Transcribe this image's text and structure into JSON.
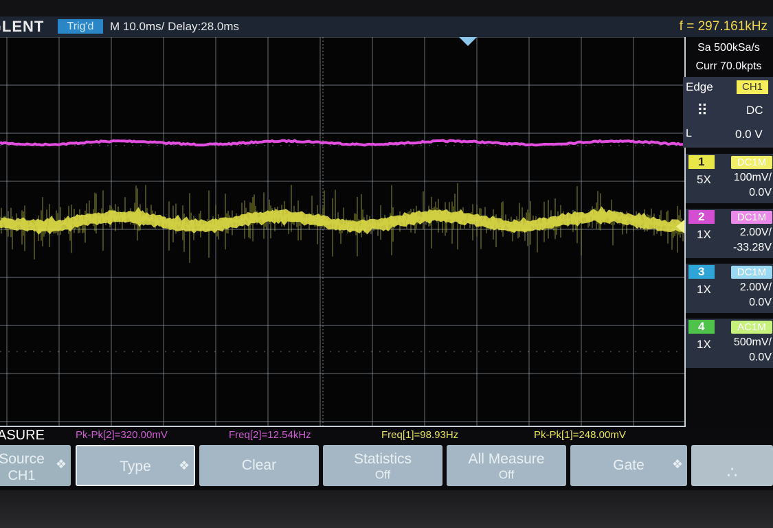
{
  "header": {
    "brand": "SIGLENT",
    "trigger_status": "Trig'd",
    "timebase": "M 10.0ms/ Delay:28.0ms",
    "frequency": "f = 297.161kHz"
  },
  "acquisition": {
    "sample_rate": "Sa 500kSa/s",
    "memory": "Curr 70.0kpts"
  },
  "trigger": {
    "type": "Edge",
    "source": "CH1",
    "slope_icon": "rising-edge-icon",
    "coupling": "DC",
    "level_label": "L",
    "level": "0.0 V"
  },
  "channels": [
    {
      "num": "1",
      "coupling": "DC1M",
      "probe": "5X",
      "scale": "100mV/",
      "offset": "0.0V",
      "color": "#e9e64a"
    },
    {
      "num": "2",
      "coupling": "DC1M",
      "probe": "1X",
      "scale": "2.00V/",
      "offset": "-33.28V",
      "color": "#e24ee0"
    },
    {
      "num": "3",
      "coupling": "DC1M",
      "probe": "1X",
      "scale": "2.00V/",
      "offset": "0.0V",
      "color": "#39c0ea"
    },
    {
      "num": "4",
      "coupling": "AC1M",
      "probe": "1X",
      "scale": "500mV/",
      "offset": "0.0V",
      "color": "#5bdc52"
    }
  ],
  "measure": {
    "title": "MEASURE",
    "items": [
      {
        "text": "Pk-Pk[2]=320.00mV",
        "color": "#d05ad6"
      },
      {
        "text": "Freq[2]=12.54kHz",
        "color": "#d05ad6"
      },
      {
        "text": "Freq[1]=98.93Hz",
        "color": "#e8e45a"
      },
      {
        "text": "Pk-Pk[1]=248.00mV",
        "color": "#e8e45a"
      }
    ]
  },
  "softkeys": [
    {
      "line1": "Source",
      "line2": "CH1"
    },
    {
      "line1": "Type",
      "line2": ""
    },
    {
      "line1": "Clear",
      "line2": ""
    },
    {
      "line1": "Statistics",
      "line2": "Off"
    },
    {
      "line1": "All Measure",
      "line2": "Off"
    },
    {
      "line1": "Gate",
      "line2": ""
    }
  ],
  "colors": {
    "ch1": "#e9e64a",
    "ch2": "#e24ee0",
    "grid": "#8f9aa6",
    "accent": "#2a86c6"
  }
}
